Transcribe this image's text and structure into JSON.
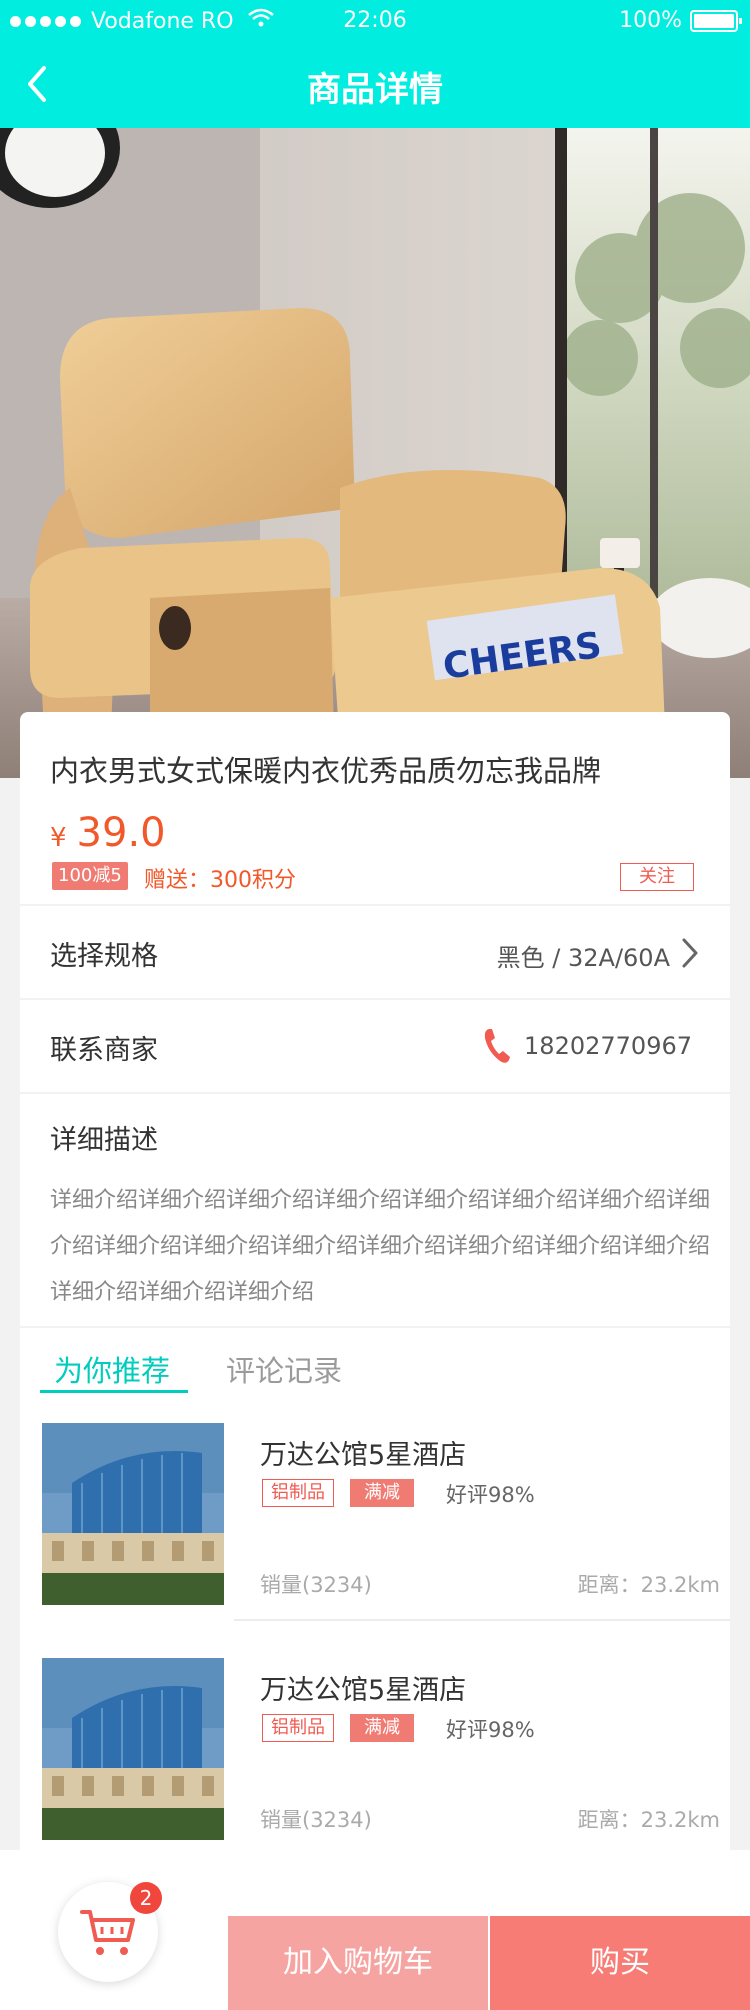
{
  "status_bar": {
    "carrier": "Vodafone RO",
    "time": "22:06",
    "battery": "100%"
  },
  "nav": {
    "title": "商品详情"
  },
  "product": {
    "title": "内衣男式女式保暖内衣优秀品质勿忘我品牌",
    "currency": "¥",
    "price": "39.0",
    "discount_tag": "100减5",
    "gift": "赠送：300积分",
    "follow_label": "关注"
  },
  "spec": {
    "label": "选择规格",
    "value": "黑色 / 32A/60A"
  },
  "contact": {
    "label": "联系商家",
    "phone": "18202770967"
  },
  "description": {
    "title": "详细描述",
    "text": "详细介绍详细介绍详细介绍详细介绍详细介绍详细介绍详细介绍详细介绍详细介绍详细介绍详细介绍详细介绍详细介绍详细介绍详细介绍详细介绍详细介绍详细介绍"
  },
  "tabs": [
    {
      "label": "为你推荐",
      "active": true
    },
    {
      "label": "评论记录",
      "active": false
    }
  ],
  "recommendations": [
    {
      "name": "万达公馆5星酒店",
      "tag1": "铝制品",
      "tag2": "满减",
      "rating": "好评98%",
      "sales": "销量(3234)",
      "distance": "距离：23.2km"
    },
    {
      "name": "万达公馆5星酒店",
      "tag1": "铝制品",
      "tag2": "满减",
      "rating": "好评98%",
      "sales": "销量(3234)",
      "distance": "距离：23.2km"
    }
  ],
  "bottom_bar": {
    "cart_count": "2",
    "add_to_cart": "加入购物车",
    "buy": "购买"
  },
  "colors": {
    "header": "#00ede0",
    "price": "#f1582a",
    "accent_tab": "#00cdbd",
    "button_cart": "#f6a4a1",
    "button_buy": "#f67c75"
  }
}
